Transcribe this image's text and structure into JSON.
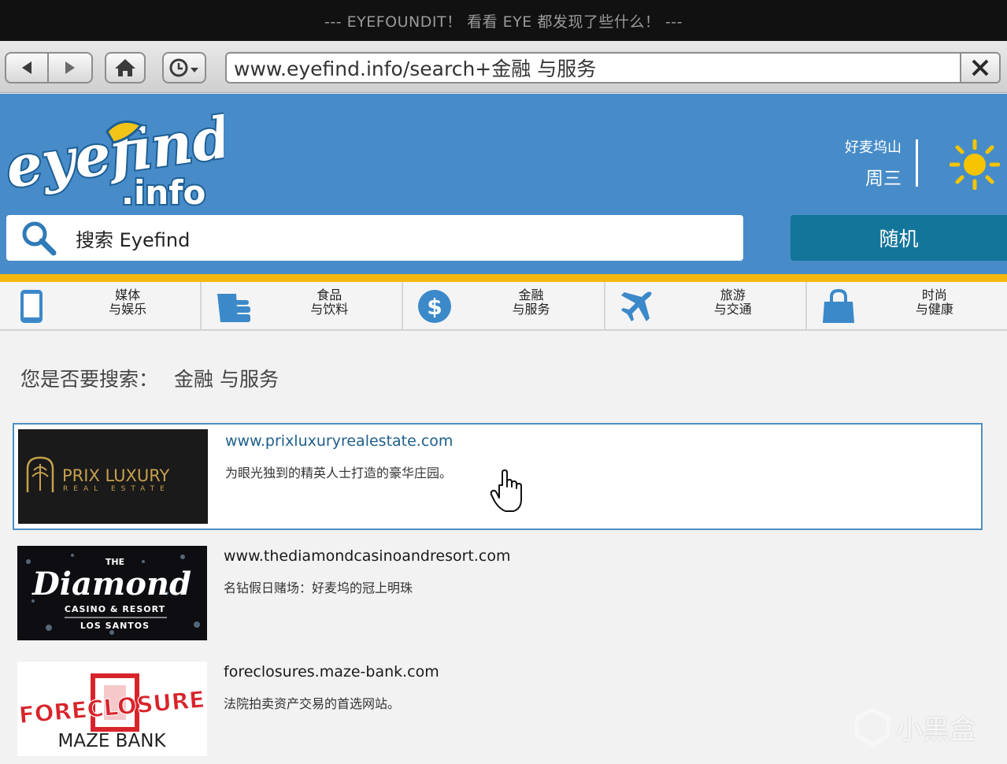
{
  "window": {
    "title": "--- EYEFOUNDIT！ 看看 EYE 都发现了些什么！ ---"
  },
  "browser": {
    "url": "www.eyefind.info/search+金融 与服务",
    "back_icon": "back-arrow-icon",
    "forward_icon": "forward-arrow-icon",
    "home_icon": "home-icon",
    "history_icon": "clock-history-icon",
    "close_icon": "close-x-icon"
  },
  "header": {
    "logo_text": "eyefind",
    "logo_sub": ".info",
    "weather": {
      "location": "好麦坞山",
      "day": "周三",
      "icon": "sun-icon"
    },
    "search": {
      "placeholder": "搜索 Eyefind",
      "icon": "magnifier-icon"
    },
    "random_label": "随机"
  },
  "categories": [
    {
      "line1": "媒体",
      "line2": "与娱乐",
      "icon": "phone-icon"
    },
    {
      "line1": "食品",
      "line2": "与饮料",
      "icon": "food-icon"
    },
    {
      "line1": "金融",
      "line2": "与服务",
      "icon": "dollar-icon"
    },
    {
      "line1": "旅游",
      "line2": "与交通",
      "icon": "airplane-icon"
    },
    {
      "line1": "时尚",
      "line2": "与健康",
      "icon": "shopping-bag-icon"
    }
  ],
  "did_you_mean": {
    "prompt": "您是否要搜索：",
    "query": "金融 与服务"
  },
  "results": [
    {
      "url": "www.prixluxuryrealestate.com",
      "description": "为眼光独到的精英人士打造的豪华庄园。",
      "thumb_title": "PRIX LUXURY",
      "thumb_sub": "REAL ESTATE"
    },
    {
      "url": "www.thediamondcasinoandresort.com",
      "description": "名钻假日赌场：好麦坞的冠上明珠",
      "thumb_top": "THE",
      "thumb_title": "Diamond",
      "thumb_sub": "CASINO & RESORT",
      "thumb_sub2": "LOS SANTOS"
    },
    {
      "url": "foreclosures.maze-bank.com",
      "description": "法院拍卖资产交易的首选网站。",
      "thumb_title": "FORECLOSURE",
      "thumb_sub": "MAZE BANK"
    }
  ],
  "watermark": "小黑盒",
  "colors": {
    "header_blue": "#478cc8",
    "gold": "#f3b70f",
    "random_teal": "#13759a",
    "link_blue": "#1e5f8a"
  }
}
